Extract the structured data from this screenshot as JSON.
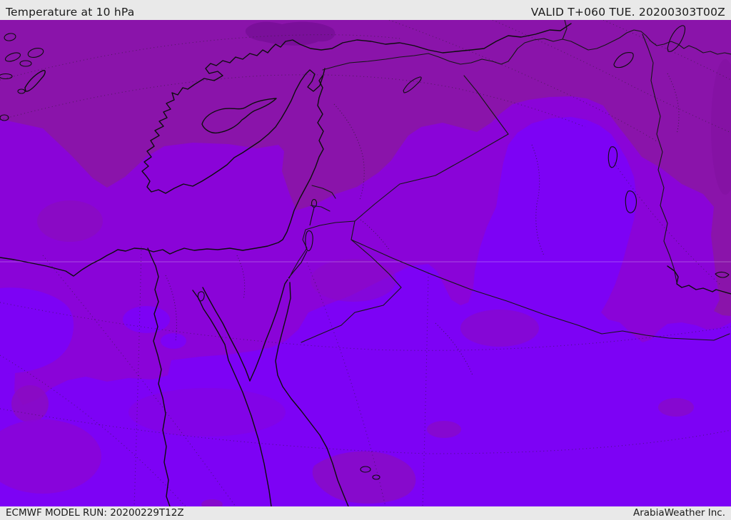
{
  "header": {
    "title": "Temperature at 10 hPa",
    "valid": "VALID T+060 TUE. 20200303T00Z"
  },
  "footer": {
    "model_run": "ECMWF MODEL RUN: 20200229T12Z",
    "credit": "ArabiaWeather Inc."
  },
  "map": {
    "description": "Stratospheric temperature shading over the Middle East / Eastern Mediterranean",
    "colors": {
      "bar_bg": "#e9e9e9",
      "bar_text": "#1b1b1b",
      "temp_darkest": "#7a0f9a",
      "temp_dark": "#8a14aa",
      "temp_mid_dark": "#8a0cc2",
      "temp_mid": "#8a04d8",
      "temp_bright": "#7d02f5",
      "coast": "#0d0d0d",
      "border": "#161616",
      "graticule": "#1d1d1d",
      "lat_line": "#ffffff"
    }
  }
}
